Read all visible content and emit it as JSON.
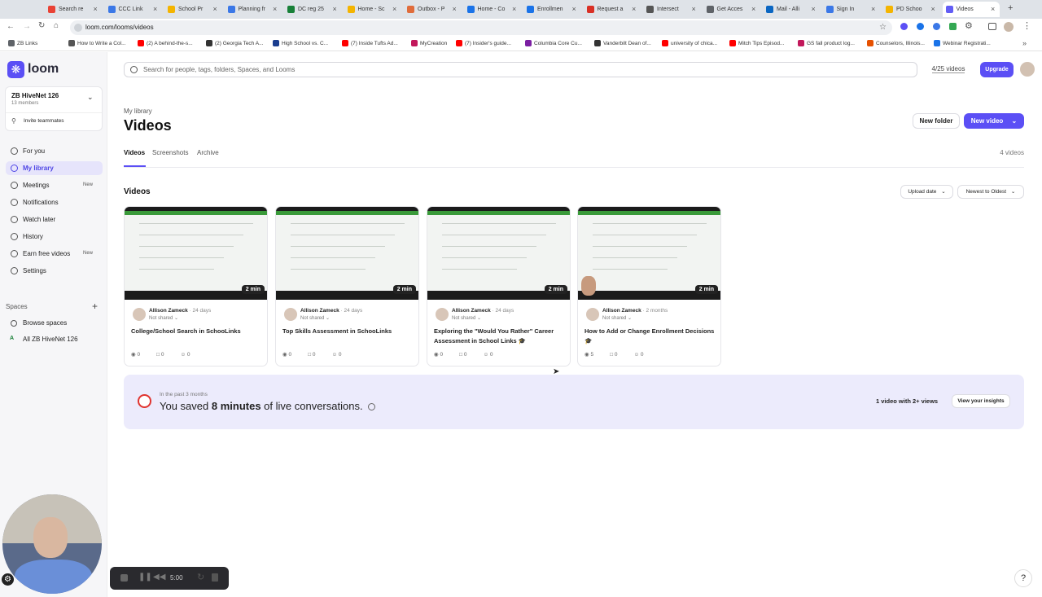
{
  "browser": {
    "tabs": [
      {
        "label": "Search re",
        "color": "#e94235"
      },
      {
        "label": "CCC Link",
        "color": "#3b78e7"
      },
      {
        "label": "School Pr",
        "color": "#f4b400"
      },
      {
        "label": "Planning fr",
        "color": "#3b78e7"
      },
      {
        "label": "DC reg 25",
        "color": "#188038"
      },
      {
        "label": "Home - Sc",
        "color": "#f4b400"
      },
      {
        "label": "Outbox - P",
        "color": "#e06c3b"
      },
      {
        "label": "Home - Co",
        "color": "#1a73e8"
      },
      {
        "label": "Enrollmen",
        "color": "#1a73e8"
      },
      {
        "label": "Request a",
        "color": "#d93025"
      },
      {
        "label": "Intersect",
        "color": "#555555"
      },
      {
        "label": "Get Acces",
        "color": "#5f6368"
      },
      {
        "label": "Mail - Alli",
        "color": "#0a66c2"
      },
      {
        "label": "Sign In",
        "color": "#3b78e7"
      },
      {
        "label": "PD Schoo",
        "color": "#f4b400"
      },
      {
        "label": "Videos",
        "color": "#625df5"
      }
    ],
    "url": "loom.com/looms/videos",
    "bookmarks": [
      {
        "label": "ZB Links",
        "color": "#5f6368"
      },
      {
        "label": "How to Write a Col...",
        "color": "#555555"
      },
      {
        "label": "(2) A behind-the-s...",
        "color": "#ff0000"
      },
      {
        "label": "(2) Georgia Tech A...",
        "color": "#333333"
      },
      {
        "label": "High School vs. C...",
        "color": "#1a3d8f"
      },
      {
        "label": "(7) Inside Tufts Ad...",
        "color": "#ff0000"
      },
      {
        "label": "MyCreation",
        "color": "#c2185b"
      },
      {
        "label": "(7) Insider's guide...",
        "color": "#ff0000"
      },
      {
        "label": "Columbia Core Cu...",
        "color": "#7b1fa2"
      },
      {
        "label": "Vanderbilt Dean of...",
        "color": "#333333"
      },
      {
        "label": "university of chica...",
        "color": "#ff0000"
      },
      {
        "label": "Mitch Tips Episod...",
        "color": "#ff0000"
      },
      {
        "label": "GS fall product log...",
        "color": "#c2185b"
      },
      {
        "label": "Counselors, Illinois...",
        "color": "#e65100"
      },
      {
        "label": "Webinar Registrati...",
        "color": "#1a73e8"
      }
    ]
  },
  "sidebar": {
    "brand": "loom",
    "workspace_name": "ZB HiveNet 126",
    "members": "13 members",
    "invite": "Invite teammates",
    "items": [
      {
        "label": "For you",
        "badge": ""
      },
      {
        "label": "My library",
        "badge": ""
      },
      {
        "label": "Meetings",
        "badge": "New"
      },
      {
        "label": "Notifications",
        "badge": ""
      },
      {
        "label": "Watch later",
        "badge": ""
      },
      {
        "label": "History",
        "badge": ""
      },
      {
        "label": "Earn free videos",
        "badge": "New"
      },
      {
        "label": "Settings",
        "badge": ""
      }
    ],
    "spaces_label": "Spaces",
    "browse_spaces": "Browse spaces",
    "space_letter": "A",
    "space_all": "All ZB HiveNet 126"
  },
  "header": {
    "search_placeholder": "Search for people, tags, folders, Spaces, and Looms",
    "quota": "4/25 videos",
    "upgrade": "Upgrade"
  },
  "main": {
    "breadcrumb": "My library",
    "title": "Videos",
    "new_folder": "New folder",
    "new_video": "New video",
    "tabs": [
      "Videos",
      "Screenshots",
      "Archive"
    ],
    "count": "4 videos",
    "section_title": "Videos",
    "sort_by": "Upload date",
    "sort_order": "Newest to Oldest",
    "videos": [
      {
        "duration": "2 min",
        "author": "Allison Zameck",
        "age": "24 days",
        "share": "Not shared",
        "title": "College/School Search in SchooLinks",
        "views": "0",
        "comments": "0",
        "reactions": "0"
      },
      {
        "duration": "2 min",
        "author": "Allison Zameck",
        "age": "24 days",
        "share": "Not shared",
        "title": "Top Skills Assessment in SchooLinks",
        "views": "0",
        "comments": "0",
        "reactions": "0"
      },
      {
        "duration": "2 min",
        "author": "Allison Zameck",
        "age": "24 days",
        "share": "Not shared",
        "title": "Exploring the \"Would You Rather\" Career Assessment in School Links 🎓",
        "views": "0",
        "comments": "0",
        "reactions": "0"
      },
      {
        "duration": "2 min",
        "author": "Allison Zameck",
        "age": "2 months",
        "share": "Not shared",
        "title": "How to Add or Change Enrollment Decisions 🎓",
        "views": "5",
        "comments": "0",
        "reactions": "0"
      }
    ],
    "insight": {
      "period": "In the past 3 months",
      "text_prefix": "You saved ",
      "text_bold": "8 minutes",
      "text_suffix": " of live conversations.",
      "views_text": "1 video with 2+ views",
      "button": "View your insights"
    }
  },
  "recorder": {
    "time": "5:00"
  }
}
